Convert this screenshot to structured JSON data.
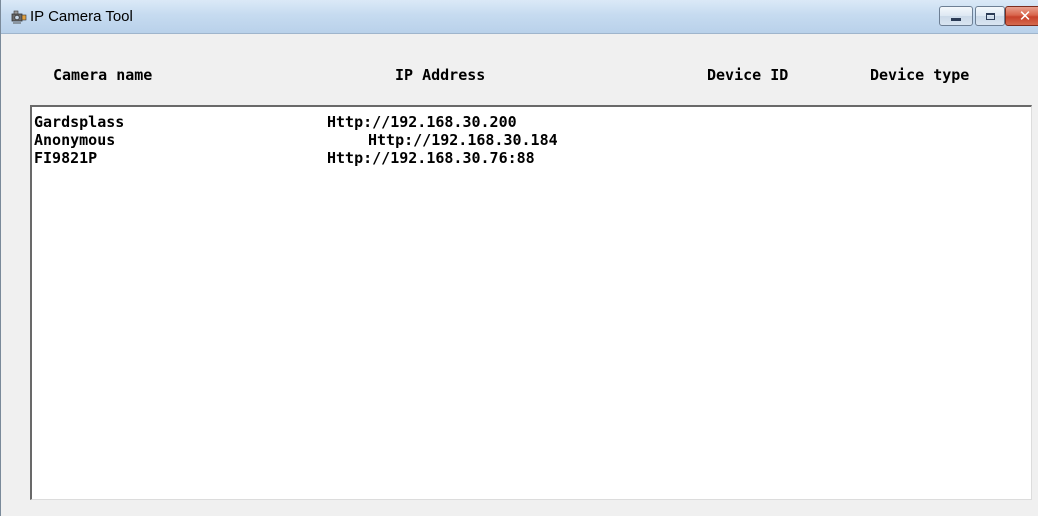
{
  "window": {
    "title": "IP Camera Tool",
    "icon": "camera-icon",
    "controls": [
      "minimize-icon",
      "maximize-icon",
      "close-icon"
    ]
  },
  "columns": {
    "camera_name": "Camera name",
    "ip_address": "IP Address",
    "device_id": "Device ID",
    "device_type": "Device type"
  },
  "cameras": [
    {
      "name": "Gardsplass",
      "ip": "Http://192.168.30.200",
      "device_id": "",
      "device_type": ""
    },
    {
      "name": "Anonymous",
      "ip": "Http://192.168.30.184",
      "device_id": "",
      "device_type": ""
    },
    {
      "name": "FI9821P",
      "ip": "Http://192.168.30.76:88",
      "device_id": "",
      "device_type": ""
    }
  ]
}
